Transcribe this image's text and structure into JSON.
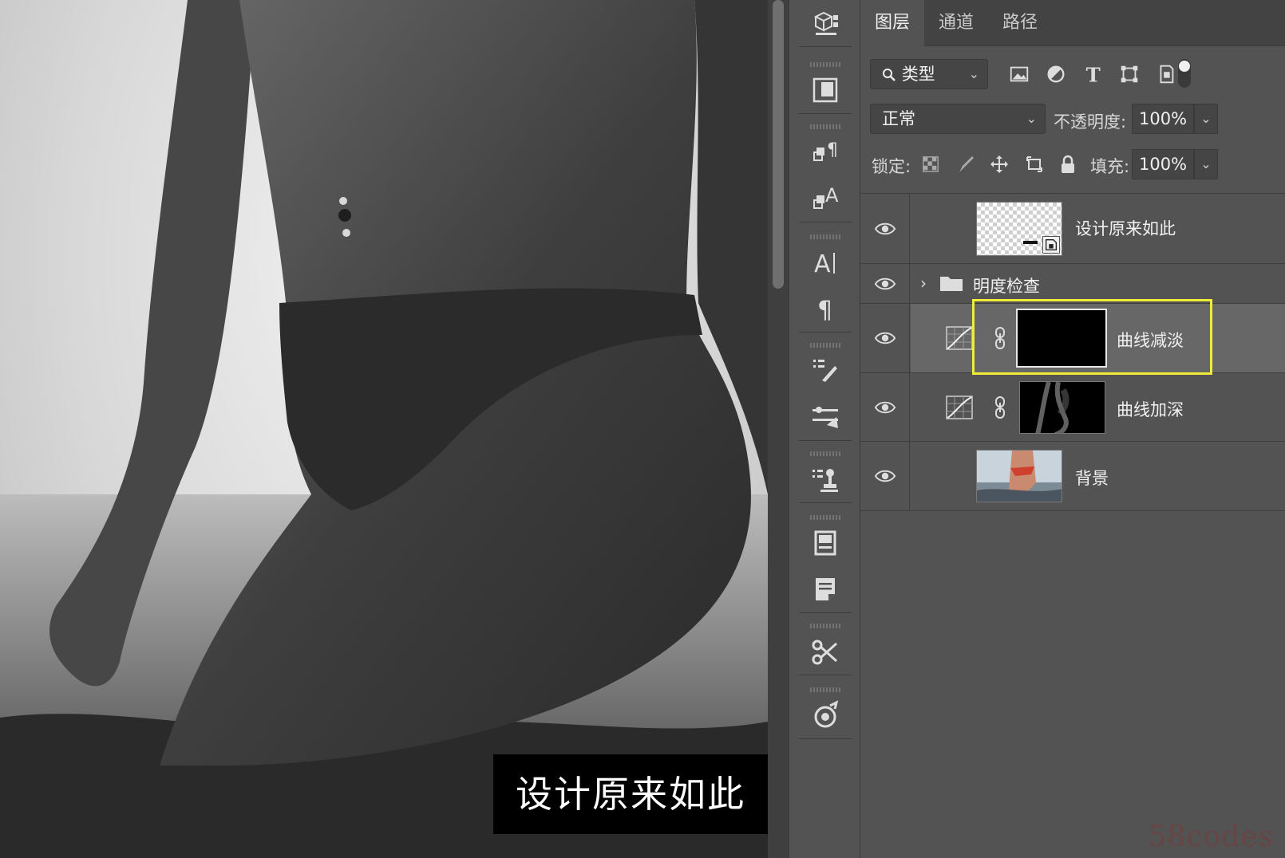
{
  "canvas": {
    "caption": "设计原来如此"
  },
  "panel": {
    "tabs": [
      {
        "label": "图层",
        "active": true
      },
      {
        "label": "通道",
        "active": false
      },
      {
        "label": "路径",
        "active": false
      }
    ],
    "filter": {
      "kind_label": "类型",
      "icons": [
        "image-filter-icon",
        "adjustment-filter-icon",
        "type-filter-icon",
        "shape-filter-icon",
        "smart-object-filter-icon",
        "filter-toggle"
      ]
    },
    "blend_mode": "正常",
    "opacity_label": "不透明度:",
    "opacity_value": "100%",
    "lock_label": "锁定:",
    "fill_label": "填充:",
    "fill_value": "100%"
  },
  "layers": [
    {
      "name": "设计原来如此",
      "type": "smart-object",
      "visible": true,
      "selected": false
    },
    {
      "name": "明度检查",
      "type": "group",
      "visible": true,
      "selected": false
    },
    {
      "name": "曲线减淡",
      "type": "curves-adjustment",
      "visible": true,
      "selected": true,
      "mask": "black"
    },
    {
      "name": "曲线加深",
      "type": "curves-adjustment",
      "visible": true,
      "selected": false,
      "mask": "figure"
    },
    {
      "name": "背景",
      "type": "pixel",
      "visible": true,
      "selected": false
    }
  ],
  "colors": {
    "highlight": "#f1ec3a",
    "panel_bg": "#535353"
  },
  "watermark": "58codes"
}
